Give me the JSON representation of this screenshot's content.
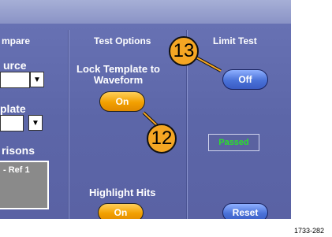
{
  "compare_column": {
    "header": "mpare",
    "source_label": "urce",
    "template_label": "plate",
    "comparisons_label": "risons",
    "comparisons_item": "- Ref 1",
    "dropdown_glyph": "▼"
  },
  "test_options": {
    "header": "Test Options",
    "lock_template_label": "Lock Template to Waveform",
    "lock_template_button": "On",
    "highlight_hits_label": "Highlight Hits",
    "highlight_hits_button": "On"
  },
  "limit_test": {
    "header": "Limit Test",
    "button": "Off",
    "status": "Passed",
    "reset_button": "Reset"
  },
  "callouts": [
    "13",
    "12"
  ],
  "figure_id": "1733-282",
  "colors": {
    "panel": "#5c66a8",
    "button_on": "#f2a000",
    "button_off": "#4a72d8",
    "status_text": "#2be02b",
    "callout": "#f5a623"
  }
}
